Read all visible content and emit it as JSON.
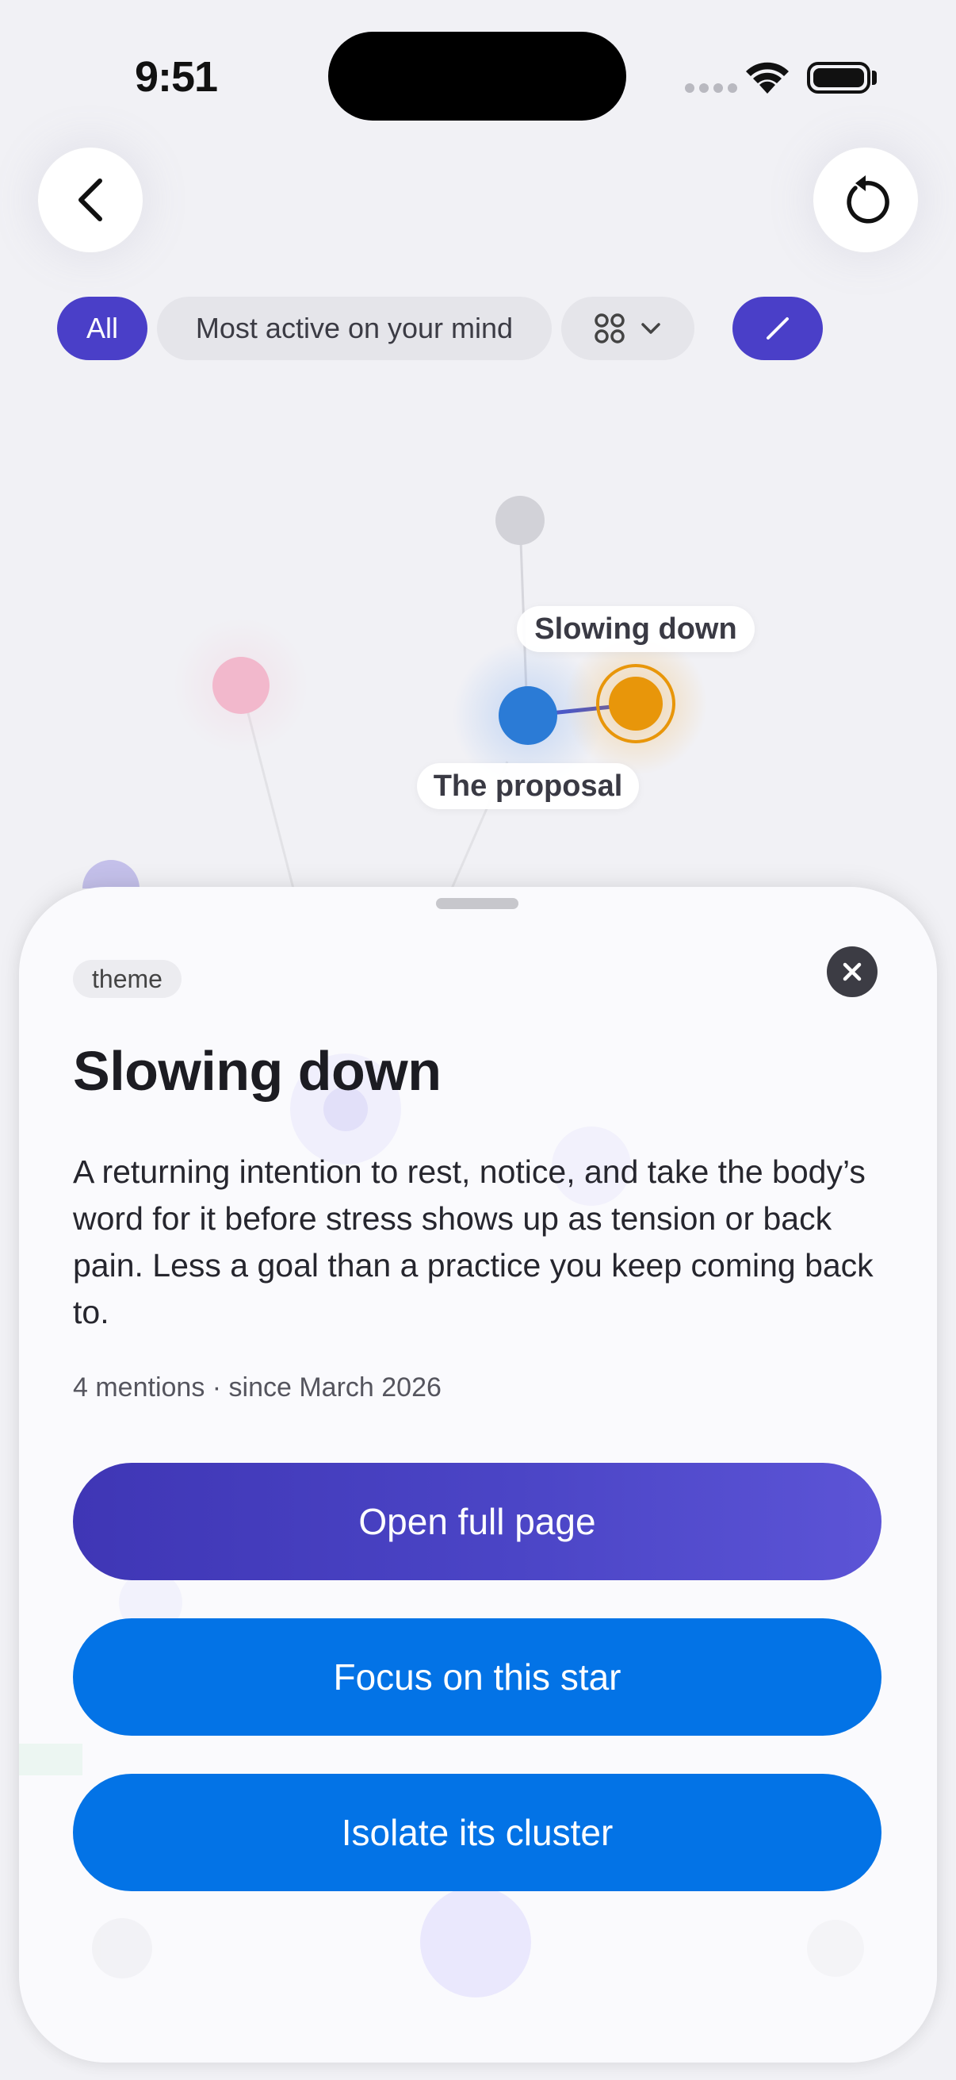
{
  "status_bar": {
    "time": "9:51"
  },
  "filters": {
    "all_label": "All",
    "sort_label": "Most active on your mind"
  },
  "graph": {
    "labels": {
      "slowing": "Slowing down",
      "proposal": "The proposal"
    },
    "colors": {
      "selected": "#e8960a",
      "proposal": "#2b7bd6",
      "pink": "#f2b8cc",
      "gray": "#d2d2d8",
      "lavender": "#c4c0ea"
    }
  },
  "sheet": {
    "tag": "theme",
    "title": "Slowing down",
    "description": "A returning intention to rest, notice, and take the body’s word for it before stress shows up as tension or back pain. Less a goal than a practice you keep coming back to.",
    "meta": "4 mentions · since March 2026",
    "buttons": {
      "open": "Open full page",
      "focus": "Focus on this star",
      "isolate": "Isolate its cluster"
    }
  },
  "colors": {
    "accent": "#4a3fc8",
    "primary_blue": "#0373e6"
  }
}
